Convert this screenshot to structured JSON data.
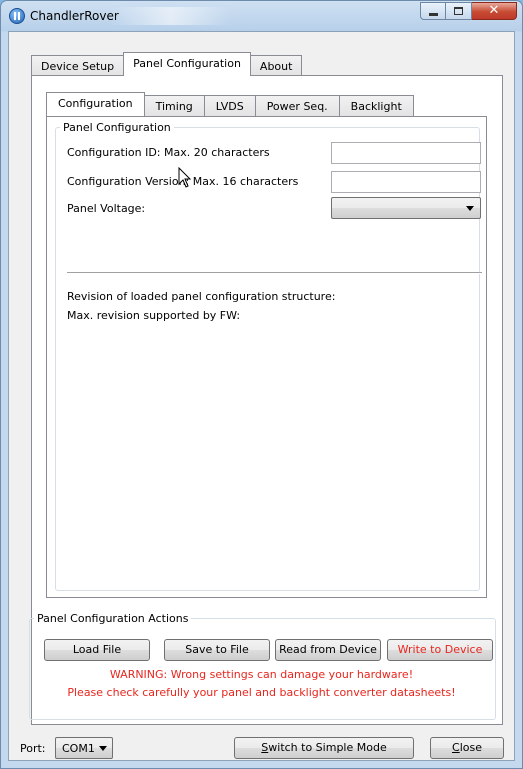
{
  "window": {
    "title": "ChandlerRover",
    "close_glyph": "✕"
  },
  "main_tabs": [
    {
      "label": "Device Setup"
    },
    {
      "label": "Panel Configuration",
      "active": true
    },
    {
      "label": "About"
    }
  ],
  "sub_tabs": [
    {
      "label": "Configuration",
      "active": true
    },
    {
      "label": "Timing"
    },
    {
      "label": "LVDS"
    },
    {
      "label": "Power Seq."
    },
    {
      "label": "Backlight"
    }
  ],
  "panel_config": {
    "group_title": "Panel Configuration",
    "config_id_label": "Configuration ID: Max. 20 characters",
    "config_id_value": "",
    "config_version_label": "Configuration Version: Max. 16 characters",
    "config_version_value": "",
    "panel_voltage_label": "Panel Voltage:",
    "panel_voltage_value": "",
    "revision_loaded_label": "Revision of loaded panel configuration structure:",
    "max_revision_label": "Max. revision supported by FW:"
  },
  "actions": {
    "group_title": "Panel Configuration Actions",
    "load_file": "Load File",
    "save_to_file": "Save to File",
    "read_from_device": "Read from Device",
    "write_to_device": "Write to Device",
    "warning_line1": "WARNING: Wrong settings can damage your hardware!",
    "warning_line2": "Please check carefully your panel and backlight converter datasheets!"
  },
  "bottom": {
    "port_label": "Port:",
    "port_value": "COM1",
    "switch_mode_prefix": "",
    "switch_mode_underlined": "S",
    "switch_mode_rest": "witch to Simple Mode",
    "close_underlined": "C",
    "close_rest": "lose"
  },
  "colors": {
    "warning": "#e8261e",
    "titlebar": "#b7d0ea",
    "close_button": "#c74b33"
  },
  "icons": {
    "app": "app-icon",
    "minimize": "minimize-icon",
    "maximize": "maximize-icon",
    "close": "close-icon",
    "cursor": "mouse-cursor-icon"
  }
}
